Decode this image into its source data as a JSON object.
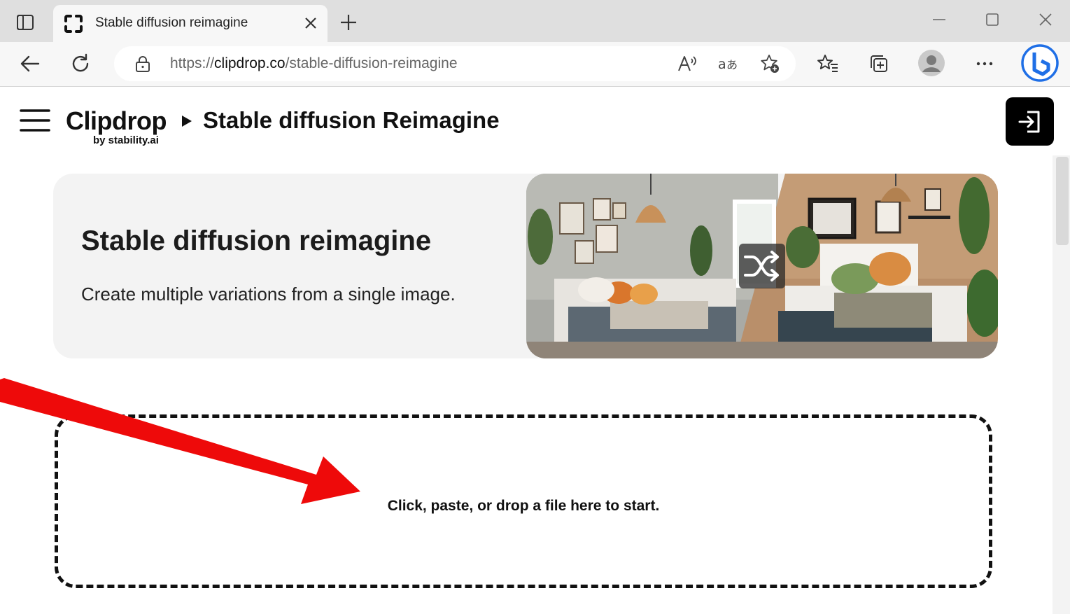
{
  "browser": {
    "tab": {
      "title": "Stable diffusion reimagine"
    },
    "address": {
      "scheme": "https://",
      "host": "clipdrop.co",
      "path": "/stable-diffusion-reimagine"
    },
    "icons": [
      "tab-actions-icon",
      "tab-favicon",
      "close-icon",
      "plus-icon",
      "minimize-icon",
      "maximize-icon",
      "window-close-icon",
      "back-arrow-icon",
      "reload-icon",
      "lock-icon",
      "read-aloud-icon",
      "translate-icon",
      "add-favorite-icon",
      "favorites-icon",
      "collections-icon",
      "profile-avatar-icon",
      "more-icon",
      "copilot-icon"
    ]
  },
  "header": {
    "logo": "Clipdrop",
    "logo_sub": "by stability.ai",
    "title": "Stable diffusion Reimagine"
  },
  "hero": {
    "title": "Stable diffusion reimagine",
    "subtitle": "Create multiple variations from a single image."
  },
  "dropzone": {
    "text": "Click, paste, or drop a file here to start."
  },
  "colors": {
    "arrow": "#ee0a0a",
    "login_button": "#000000",
    "hero_bg": "#f3f3f3",
    "copilot": "#1f6fe6"
  }
}
